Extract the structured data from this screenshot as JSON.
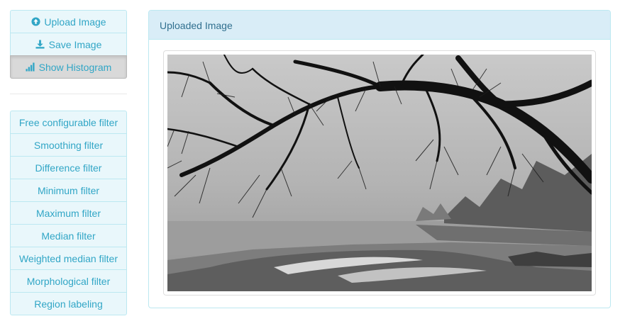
{
  "toolbar": {
    "upload_label": "Upload Image",
    "save_label": "Save Image",
    "histogram_label": "Show Histogram"
  },
  "filters": [
    {
      "label": "Free configurable filter"
    },
    {
      "label": "Smoothing filter"
    },
    {
      "label": "Difference filter"
    },
    {
      "label": "Minimum filter"
    },
    {
      "label": "Maximum filter"
    },
    {
      "label": "Median filter"
    },
    {
      "label": "Weighted median filter"
    },
    {
      "label": "Morphological filter"
    },
    {
      "label": "Region labeling"
    }
  ],
  "panel": {
    "title": "Uploaded Image"
  },
  "colors": {
    "accent": "#31a6c6",
    "panel_heading_bg": "#d9edf7",
    "panel_border": "#bce8f1",
    "active_button_bg": "#d9d9d9"
  },
  "icons": {
    "upload": "circle-arrow-up-icon",
    "save": "download-icon",
    "histogram": "bar-chart-icon"
  }
}
